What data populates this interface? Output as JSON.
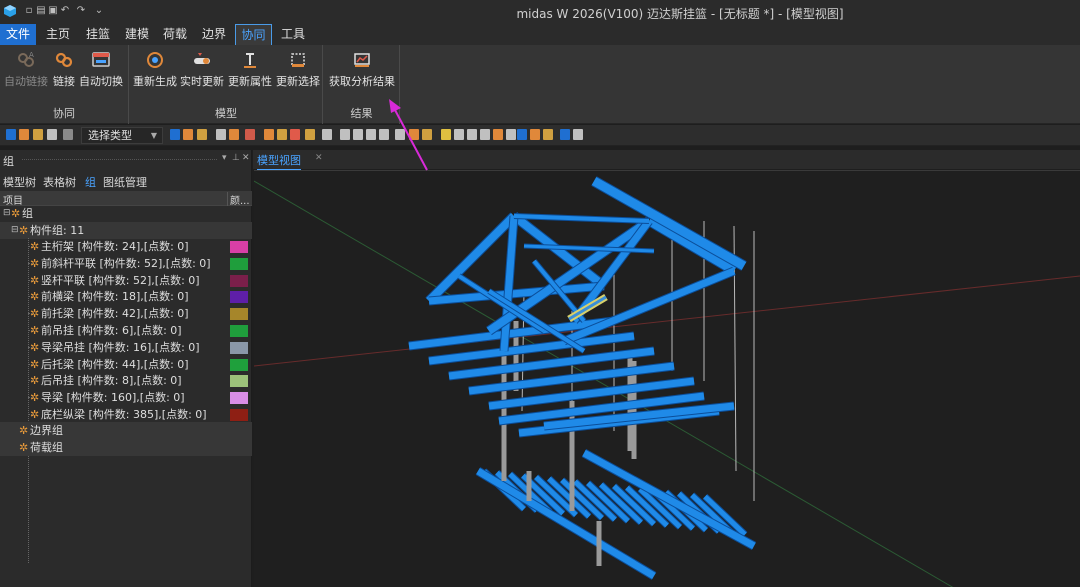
{
  "window": {
    "title": "midas W 2026(V100) 迈达斯挂篮 - [无标题 *] - [模型视图]"
  },
  "menu": {
    "tabs": [
      {
        "label": "文件"
      },
      {
        "label": "主页"
      },
      {
        "label": "挂篮"
      },
      {
        "label": "建模"
      },
      {
        "label": "荷载"
      },
      {
        "label": "边界"
      },
      {
        "label": "协同"
      },
      {
        "label": "工具"
      }
    ],
    "active_tab": "协同"
  },
  "ribbon": {
    "groups": [
      {
        "label": "协同",
        "buttons": [
          {
            "label": "自动链接",
            "icon": "auto-link-icon",
            "enabled": false
          },
          {
            "label": "链接",
            "icon": "link-icon",
            "enabled": true
          },
          {
            "label": "自动切换",
            "icon": "auto-switch-icon",
            "enabled": true
          }
        ]
      },
      {
        "label": "模型",
        "buttons": [
          {
            "label": "重新生成",
            "icon": "regenerate-icon",
            "enabled": true
          },
          {
            "label": "实时更新",
            "icon": "realtime-update-icon",
            "enabled": true
          },
          {
            "label": "更新属性",
            "icon": "update-properties-icon",
            "enabled": true
          },
          {
            "label": "更新选择",
            "icon": "update-selection-icon",
            "enabled": true
          }
        ]
      },
      {
        "label": "结果",
        "buttons": [
          {
            "label": "获取分析结果",
            "icon": "get-analysis-results-icon",
            "enabled": true
          }
        ]
      }
    ]
  },
  "toolbar": {
    "select_type": "选择类型"
  },
  "left_panel": {
    "title": "组",
    "tabs": [
      {
        "label": "模型树"
      },
      {
        "label": "表格树"
      },
      {
        "label": "组"
      },
      {
        "label": "图纸管理"
      }
    ],
    "active_tab": "组",
    "columns": {
      "item": "项目",
      "color": "颜..."
    },
    "root": "组",
    "member_group_label": "构件组: 11",
    "member_groups": [
      {
        "label": "主桁架 [构件数: 24],[点数: 0]",
        "color": "#d93fa6"
      },
      {
        "label": "前斜杆平联 [构件数: 52],[点数: 0]",
        "color": "#1f9e3c"
      },
      {
        "label": "竖杆平联 [构件数: 52],[点数: 0]",
        "color": "#7a1f4a"
      },
      {
        "label": "前横梁 [构件数: 18],[点数: 0]",
        "color": "#5e1fa8"
      },
      {
        "label": "前托梁 [构件数: 42],[点数: 0]",
        "color": "#a6862a"
      },
      {
        "label": "前吊挂 [构件数: 6],[点数: 0]",
        "color": "#1f9e3c"
      },
      {
        "label": "导梁吊挂 [构件数: 16],[点数: 0]",
        "color": "#8a97a8"
      },
      {
        "label": "后托梁 [构件数: 44],[点数: 0]",
        "color": "#1fa03c"
      },
      {
        "label": "后吊挂 [构件数: 8],[点数: 0]",
        "color": "#9cc27a"
      },
      {
        "label": "导梁 [构件数: 160],[点数: 0]",
        "color": "#d98ee6"
      },
      {
        "label": "底栏纵梁 [构件数: 385],[点数: 0]",
        "color": "#8e1f14"
      }
    ],
    "boundary_group": "边界组",
    "load_group": "荷载组"
  },
  "document": {
    "tab": "模型视图"
  },
  "colors": {
    "accent": "#4aa3ff",
    "model_blue": "#1f8ae8",
    "annotation": "#d92ad9"
  }
}
